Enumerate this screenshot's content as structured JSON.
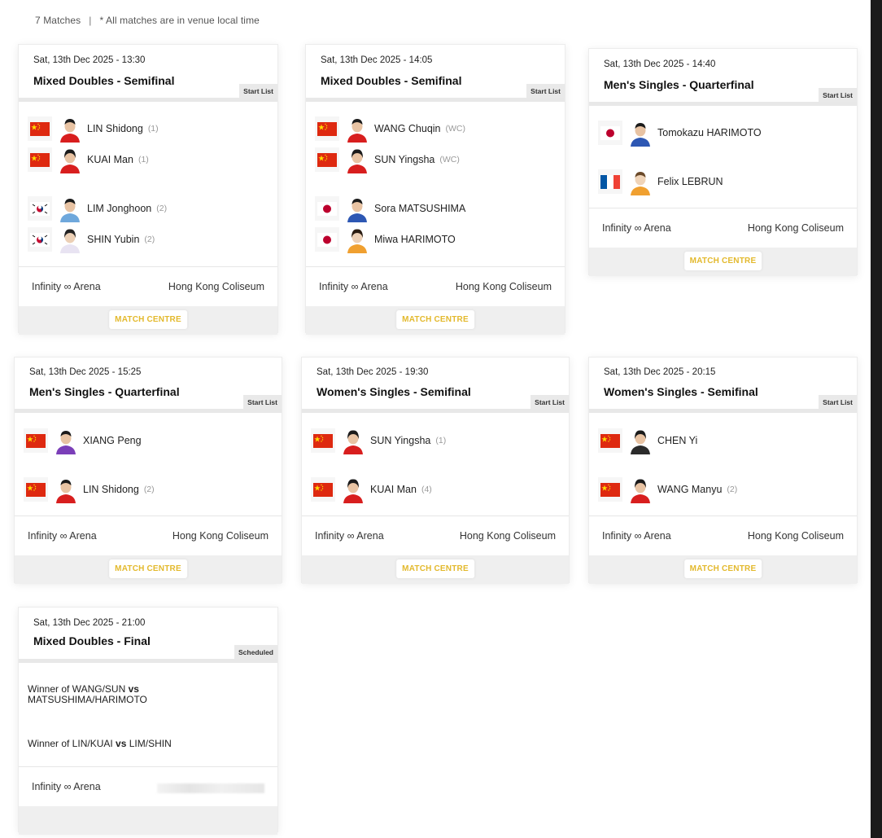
{
  "header": {
    "match_count": "7 Matches",
    "separator": "|",
    "note": "* All matches are in venue local time"
  },
  "common": {
    "match_centre_label": "MATCH CENTRE"
  },
  "colors": {
    "accent": "#e3b92d",
    "footer_bg": "#efefef",
    "china_red": "#de2910",
    "china_star": "#ffde00",
    "japan_red": "#bc002d",
    "france_blue": "#0055a4",
    "france_red": "#ef4135"
  },
  "matches": [
    {
      "datetime": "Sat, 13th Dec 2025 - 13:30",
      "title": "Mixed Doubles - Semifinal",
      "tag": "Start List",
      "players": [
        {
          "flag": "china-flag",
          "name": "LIN Shidong",
          "seed": "(1)"
        },
        {
          "flag": "china-flag",
          "name": "KUAI Man",
          "seed": "(1)"
        },
        {
          "flag": "korea-flag",
          "name": "LIM Jonghoon",
          "seed": "(2)"
        },
        {
          "flag": "korea-flag",
          "name": "SHIN Yubin",
          "seed": "(2)"
        }
      ],
      "arena": "Infinity ∞ Arena",
      "location": "Hong Kong Coliseum"
    },
    {
      "datetime": "Sat, 13th Dec 2025 - 14:05",
      "title": "Mixed Doubles - Semifinal",
      "tag": "Start List",
      "players": [
        {
          "flag": "china-flag",
          "name": "WANG Chuqin",
          "seed": "(WC)"
        },
        {
          "flag": "china-flag",
          "name": "SUN Yingsha",
          "seed": "(WC)"
        },
        {
          "flag": "japan-flag",
          "name": "Sora MATSUSHIMA",
          "seed": ""
        },
        {
          "flag": "japan-flag",
          "name": "Miwa HARIMOTO",
          "seed": ""
        }
      ],
      "arena": "Infinity ∞ Arena",
      "location": "Hong Kong Coliseum"
    },
    {
      "datetime": "Sat, 13th Dec 2025 - 14:40",
      "title": "Men's Singles - Quarterfinal",
      "tag": "Start List",
      "players": [
        {
          "flag": "japan-flag",
          "name": "Tomokazu HARIMOTO",
          "seed": ""
        },
        {
          "flag": "france-flag",
          "name": "Felix LEBRUN",
          "seed": ""
        }
      ],
      "arena": "Infinity ∞ Arena",
      "location": "Hong Kong Coliseum"
    },
    {
      "datetime": "Sat, 13th Dec 2025 - 15:25",
      "title": "Men's Singles - Quarterfinal",
      "tag": "Start List",
      "players": [
        {
          "flag": "china-flag",
          "name": "XIANG Peng",
          "seed": ""
        },
        {
          "flag": "china-flag",
          "name": "LIN Shidong",
          "seed": "(2)"
        }
      ],
      "arena": "Infinity ∞ Arena",
      "location": "Hong Kong Coliseum"
    },
    {
      "datetime": "Sat, 13th Dec 2025 - 19:30",
      "title": "Women's Singles - Semifinal",
      "tag": "Start List",
      "players": [
        {
          "flag": "china-flag",
          "name": "SUN Yingsha",
          "seed": "(1)"
        },
        {
          "flag": "china-flag",
          "name": "KUAI Man",
          "seed": "(4)"
        }
      ],
      "arena": "Infinity ∞ Arena",
      "location": "Hong Kong Coliseum"
    },
    {
      "datetime": "Sat, 13th Dec 2025 - 20:15",
      "title": "Women's Singles - Semifinal",
      "tag": "Start List",
      "players": [
        {
          "flag": "china-flag",
          "name": "CHEN Yi",
          "seed": ""
        },
        {
          "flag": "china-flag",
          "name": "WANG Manyu",
          "seed": "(2)"
        }
      ],
      "arena": "Infinity ∞ Arena",
      "location": "Hong Kong Coliseum"
    },
    {
      "datetime": "Sat, 13th Dec 2025 - 21:00",
      "title": "Mixed Doubles - Final",
      "tag": "Scheduled",
      "placeholders": [
        {
          "pre": "Winner of WANG/SUN",
          "vs": "vs",
          "post": "MATSUSHIMA/HARIMOTO"
        },
        {
          "pre": "Winner of LIN/KUAI",
          "vs": "vs",
          "post": "LIM/SHIN"
        }
      ],
      "arena": "Infinity ∞ Arena"
    }
  ]
}
